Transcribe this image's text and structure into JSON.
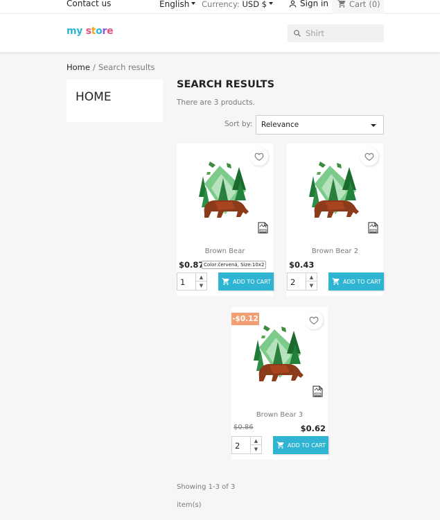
{
  "topbar": {
    "contact": "Contact us",
    "language": "English",
    "currency_label": "Currency:",
    "currency_value": "USD $",
    "signin": "Sign in",
    "cart": "Cart",
    "cart_count": "(0)"
  },
  "header": {
    "logo_my": "my",
    "logo_store": "store",
    "search_placeholder": "Shirt"
  },
  "breadcrumb": {
    "home": "Home",
    "separator": "/",
    "current": "Search results"
  },
  "sidebar": {
    "title": "HOME"
  },
  "results": {
    "title": "SEARCH RESULTS",
    "count_text": "There are 3 products.",
    "sort_label": "Sort by:",
    "sort_value": "Relevance"
  },
  "products": [
    {
      "name": "Brown Bear",
      "price": "$0.87",
      "attributes": "Color:červená, Size:10x2",
      "qty": "1",
      "add_label": "ADD TO CART",
      "svg_badge": "SVG"
    },
    {
      "name": "Brown Bear 2",
      "price": "$0.43",
      "qty": "2",
      "add_label": "ADD TO CART",
      "svg_badge": "SVG"
    },
    {
      "name": "Brown Bear 3",
      "discount": "-$0.12",
      "old_price": "$0.86",
      "price": "$0.62",
      "qty": "2",
      "add_label": "ADD TO CART",
      "svg_badge": "SVG"
    }
  ],
  "pagination": {
    "showing": "Showing 1-3 of 3",
    "items": "item(s)"
  },
  "colors": {
    "accent": "#2fb5d2",
    "discount": "#f39d72"
  }
}
